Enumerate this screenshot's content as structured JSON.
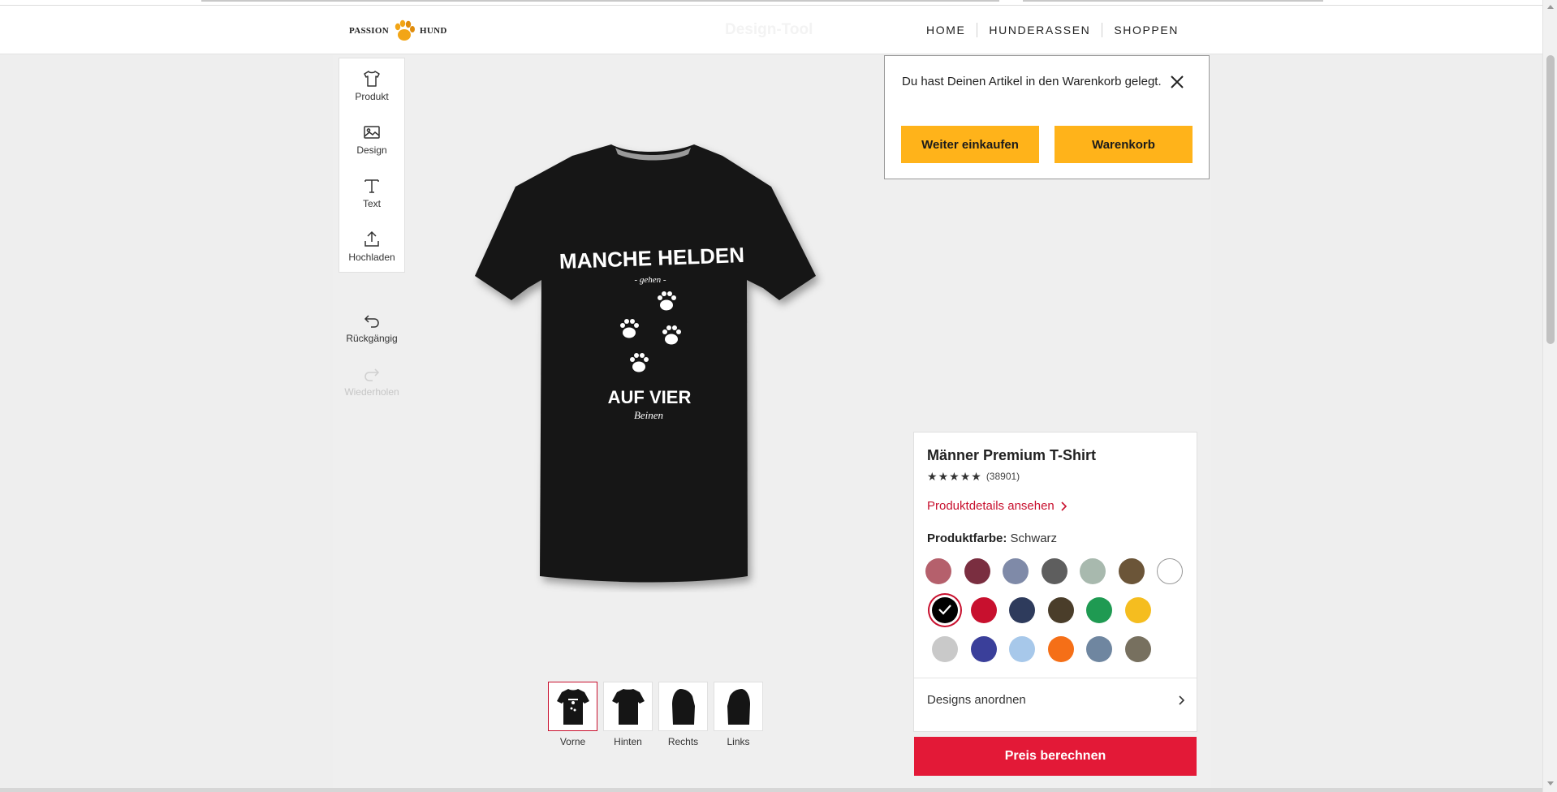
{
  "header": {
    "logo_left": "PASSION",
    "logo_right": "HUND",
    "title": "Design-Tool",
    "nav": [
      "HOME",
      "HUNDERASSEN",
      "SHOPPEN"
    ]
  },
  "tools": {
    "product": "Produkt",
    "design": "Design",
    "text": "Text",
    "upload": "Hochladen",
    "undo": "Rückgängig",
    "redo": "Wiederholen"
  },
  "shirt_print": {
    "line1": "MANCHE HELDEN",
    "line2": "- gehen -",
    "line3": "AUF VIER",
    "line4": "Beinen"
  },
  "views": [
    "Vorne",
    "Hinten",
    "Rechts",
    "Links"
  ],
  "cart_notification": {
    "message": "Du hast Deinen Artikel in den Warenkorb gelegt.",
    "continue_label": "Weiter einkaufen",
    "cart_label": "Warenkorb"
  },
  "product": {
    "name": "Männer Premium T-Shirt",
    "rating_count": "(38901)",
    "details_link": "Produktdetails ansehen",
    "color_label": "Produktfarbe:",
    "color_value": "Schwarz",
    "arrange_label": "Designs anordnen"
  },
  "colors": {
    "accent_red": "#e31937",
    "accent_yellow": "#ffb31a",
    "swatches_row1": [
      "#b5606c",
      "#7a2e40",
      "#7f8aa8",
      "#5e5e5e",
      "#a8b9ae",
      "#6b5538",
      "#ffffff"
    ],
    "swatches_row2": [
      "#000000",
      "#c8102e",
      "#2e3b5c",
      "#4a3d2a",
      "#1f9a52",
      "#f5bd1f"
    ],
    "swatches_row3": [
      "#c9c9c9",
      "#3a3f9a",
      "#a7c8ea",
      "#f56f17",
      "#6f86a0",
      "#77705f"
    ]
  },
  "price_button": "Preis berechnen"
}
